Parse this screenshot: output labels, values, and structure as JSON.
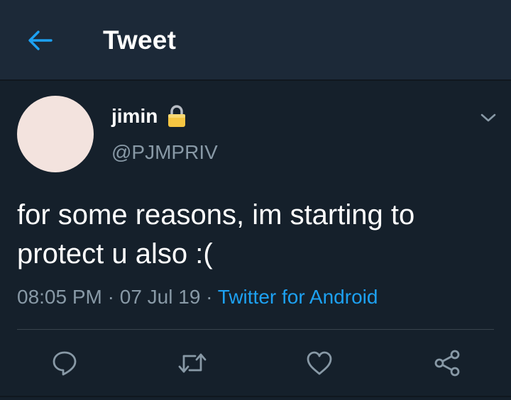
{
  "header": {
    "title": "Tweet",
    "back_icon": "arrow-left-icon"
  },
  "tweet": {
    "author": {
      "display_name": "jimin",
      "handle": "@PJMPRIV",
      "protected_icon": "lock-icon"
    },
    "text": "for some reasons, im starting to protect u also :(",
    "time": "08:05 PM",
    "separator": "·",
    "date": "07 Jul 19",
    "source": "Twitter for Android"
  },
  "actions": [
    {
      "name": "reply",
      "icon": "comment-icon"
    },
    {
      "name": "retweet",
      "icon": "retweet-icon"
    },
    {
      "name": "like",
      "icon": "heart-icon"
    },
    {
      "name": "share",
      "icon": "share-icon"
    }
  ],
  "colors": {
    "background": "#15202b",
    "header": "#1c2938",
    "accent": "#1da1f2",
    "secondary_text": "#8899a6",
    "icon": "#8899a6",
    "avatar": "#f3e3de",
    "lock": "#f5c542"
  }
}
